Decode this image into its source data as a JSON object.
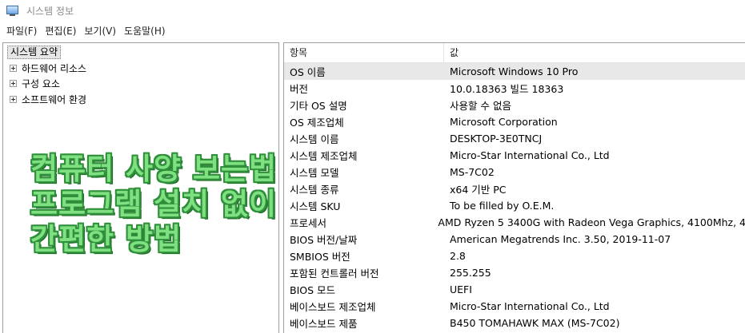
{
  "window": {
    "title": "시스템 정보",
    "icon": "system-info-icon"
  },
  "menu": [
    "파일(F)",
    "편집(E)",
    "보기(V)",
    "도움말(H)"
  ],
  "tree": {
    "root": "시스템 요약",
    "items": [
      "하드웨어 리소스",
      "구성 요소",
      "소프트웨어 환경"
    ]
  },
  "overlay": {
    "lines": [
      "컴퓨터 사양 보는법",
      "프로그램 설치 없이",
      "간편한 방법"
    ]
  },
  "table": {
    "headers": [
      "항목",
      "값"
    ],
    "rows": [
      [
        "OS 이름",
        "Microsoft Windows 10 Pro"
      ],
      [
        "버전",
        "10.0.18363 빌드 18363"
      ],
      [
        "기타 OS 설명",
        "사용할 수 없음"
      ],
      [
        "OS 제조업체",
        "Microsoft Corporation"
      ],
      [
        "시스템 이름",
        "DESKTOP-3E0TNCJ"
      ],
      [
        "시스템 제조업체",
        "Micro-Star International Co., Ltd"
      ],
      [
        "시스템 모델",
        "MS-7C02"
      ],
      [
        "시스템 종류",
        "x64 기반 PC"
      ],
      [
        "시스템 SKU",
        "To be filled by O.E.M."
      ],
      [
        "프로세서",
        "AMD Ryzen 5 3400G with Radeon Vega Graphics, 4100Mhz, 4"
      ],
      [
        "BIOS 버전/날짜",
        "American Megatrends Inc. 3.50, 2019-11-07"
      ],
      [
        "SMBIOS 버전",
        "2.8"
      ],
      [
        "포함된 컨트롤러 버전",
        "255.255"
      ],
      [
        "BIOS 모드",
        "UEFI"
      ],
      [
        "베이스보드 제조업체",
        "Micro-Star International Co., Ltd"
      ],
      [
        "베이스보드 제품",
        "B450 TOMAHAWK MAX (MS-7C02)"
      ]
    ]
  },
  "colors": {
    "overlay_fill": "#7ee081",
    "overlay_outline": "#2f8f3a",
    "selected_row": "#e8e8e8"
  }
}
